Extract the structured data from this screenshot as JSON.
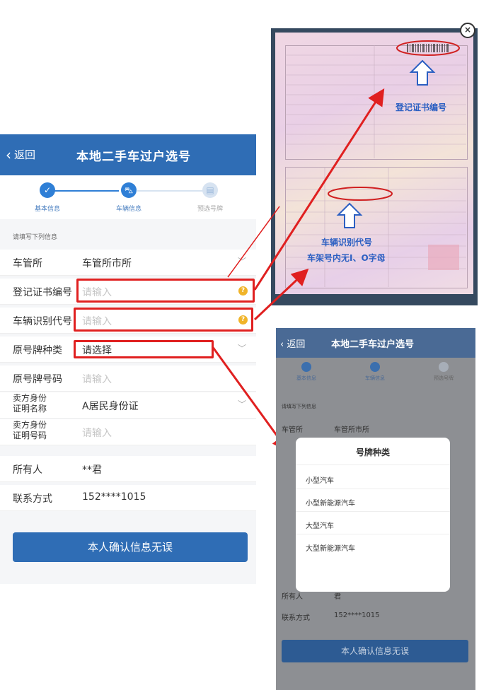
{
  "main": {
    "header": {
      "back": "返回",
      "title": "本地二手车过户选号"
    },
    "steps": [
      "基本信息",
      "车辆信息",
      "预选号牌"
    ],
    "hint": "请填写下列信息",
    "rows": [
      {
        "label": "车管所",
        "value": "车管所市所"
      },
      {
        "label": "登记证书编号",
        "placeholder": "请输入"
      },
      {
        "label": "车辆识别代号",
        "placeholder": "请输入"
      },
      {
        "label": "原号牌种类",
        "value": "请选择"
      },
      {
        "label": "原号牌号码",
        "placeholder": "请输入"
      },
      {
        "label": "卖方身份\n证明名称",
        "value": "A居民身份证"
      },
      {
        "label": "卖方身份\n证明号码",
        "placeholder": "请输入"
      },
      {
        "label": "所有人",
        "value": "**君"
      },
      {
        "label": "联系方式",
        "value": "152****1015"
      }
    ],
    "confirm_button": "本人确认信息无误"
  },
  "cert": {
    "callout_cert_no": "登记证书编号",
    "callout_vin": "车辆识别代号",
    "callout_vin_note": "车架号内无I、O字母"
  },
  "phone2": {
    "header": {
      "back": "返回",
      "title": "本地二手车过户选号"
    },
    "steps": [
      "基本信息",
      "车辆信息",
      "预选号牌"
    ],
    "hint": "请填写下列信息",
    "rows": [
      {
        "label": "车管所",
        "value": "车管所市所"
      },
      {
        "label": "所有人",
        "value": "君"
      },
      {
        "label": "联系方式",
        "value": "152****1015"
      }
    ],
    "modal": {
      "title": "号牌种类",
      "options": [
        "小型汽车",
        "小型新能源汽车",
        "大型汽车",
        "大型新能源汽车"
      ]
    },
    "confirm_button": "本人确认信息无误"
  },
  "colors": {
    "primary": "#2f6db5",
    "highlight": "#e02020",
    "warning": "#f0b429"
  }
}
